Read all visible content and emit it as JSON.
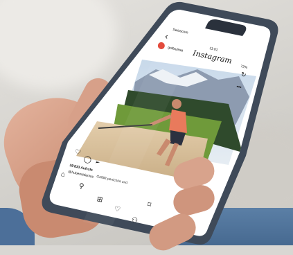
{
  "status_bar": {
    "carrier": "Swisscom",
    "time": "11:01",
    "battery": "72%"
  },
  "header": {
    "title": "Instagram"
  },
  "post": {
    "username": "golfsuisse",
    "likes": "35'833 Aufrufe",
    "caption_user": "@hubensidenice",
    "caption_text": "Gefällt penichka und"
  },
  "icons": {
    "back": "chevron-left-icon",
    "camera": "camera-icon",
    "refresh": "refresh-icon",
    "more": "more-icon",
    "like": "heart-icon",
    "comment": "comment-icon",
    "share": "send-icon",
    "save": "bookmark-icon",
    "home": "home-icon",
    "search": "search-icon",
    "add": "add-post-icon",
    "activity": "heart-icon",
    "profile": "profile-icon"
  },
  "colors": {
    "phone_frame": "#3f4a59",
    "shirt": "#e97a5c",
    "sand": "#d9c2a0",
    "grass": "#6f9a3a"
  }
}
